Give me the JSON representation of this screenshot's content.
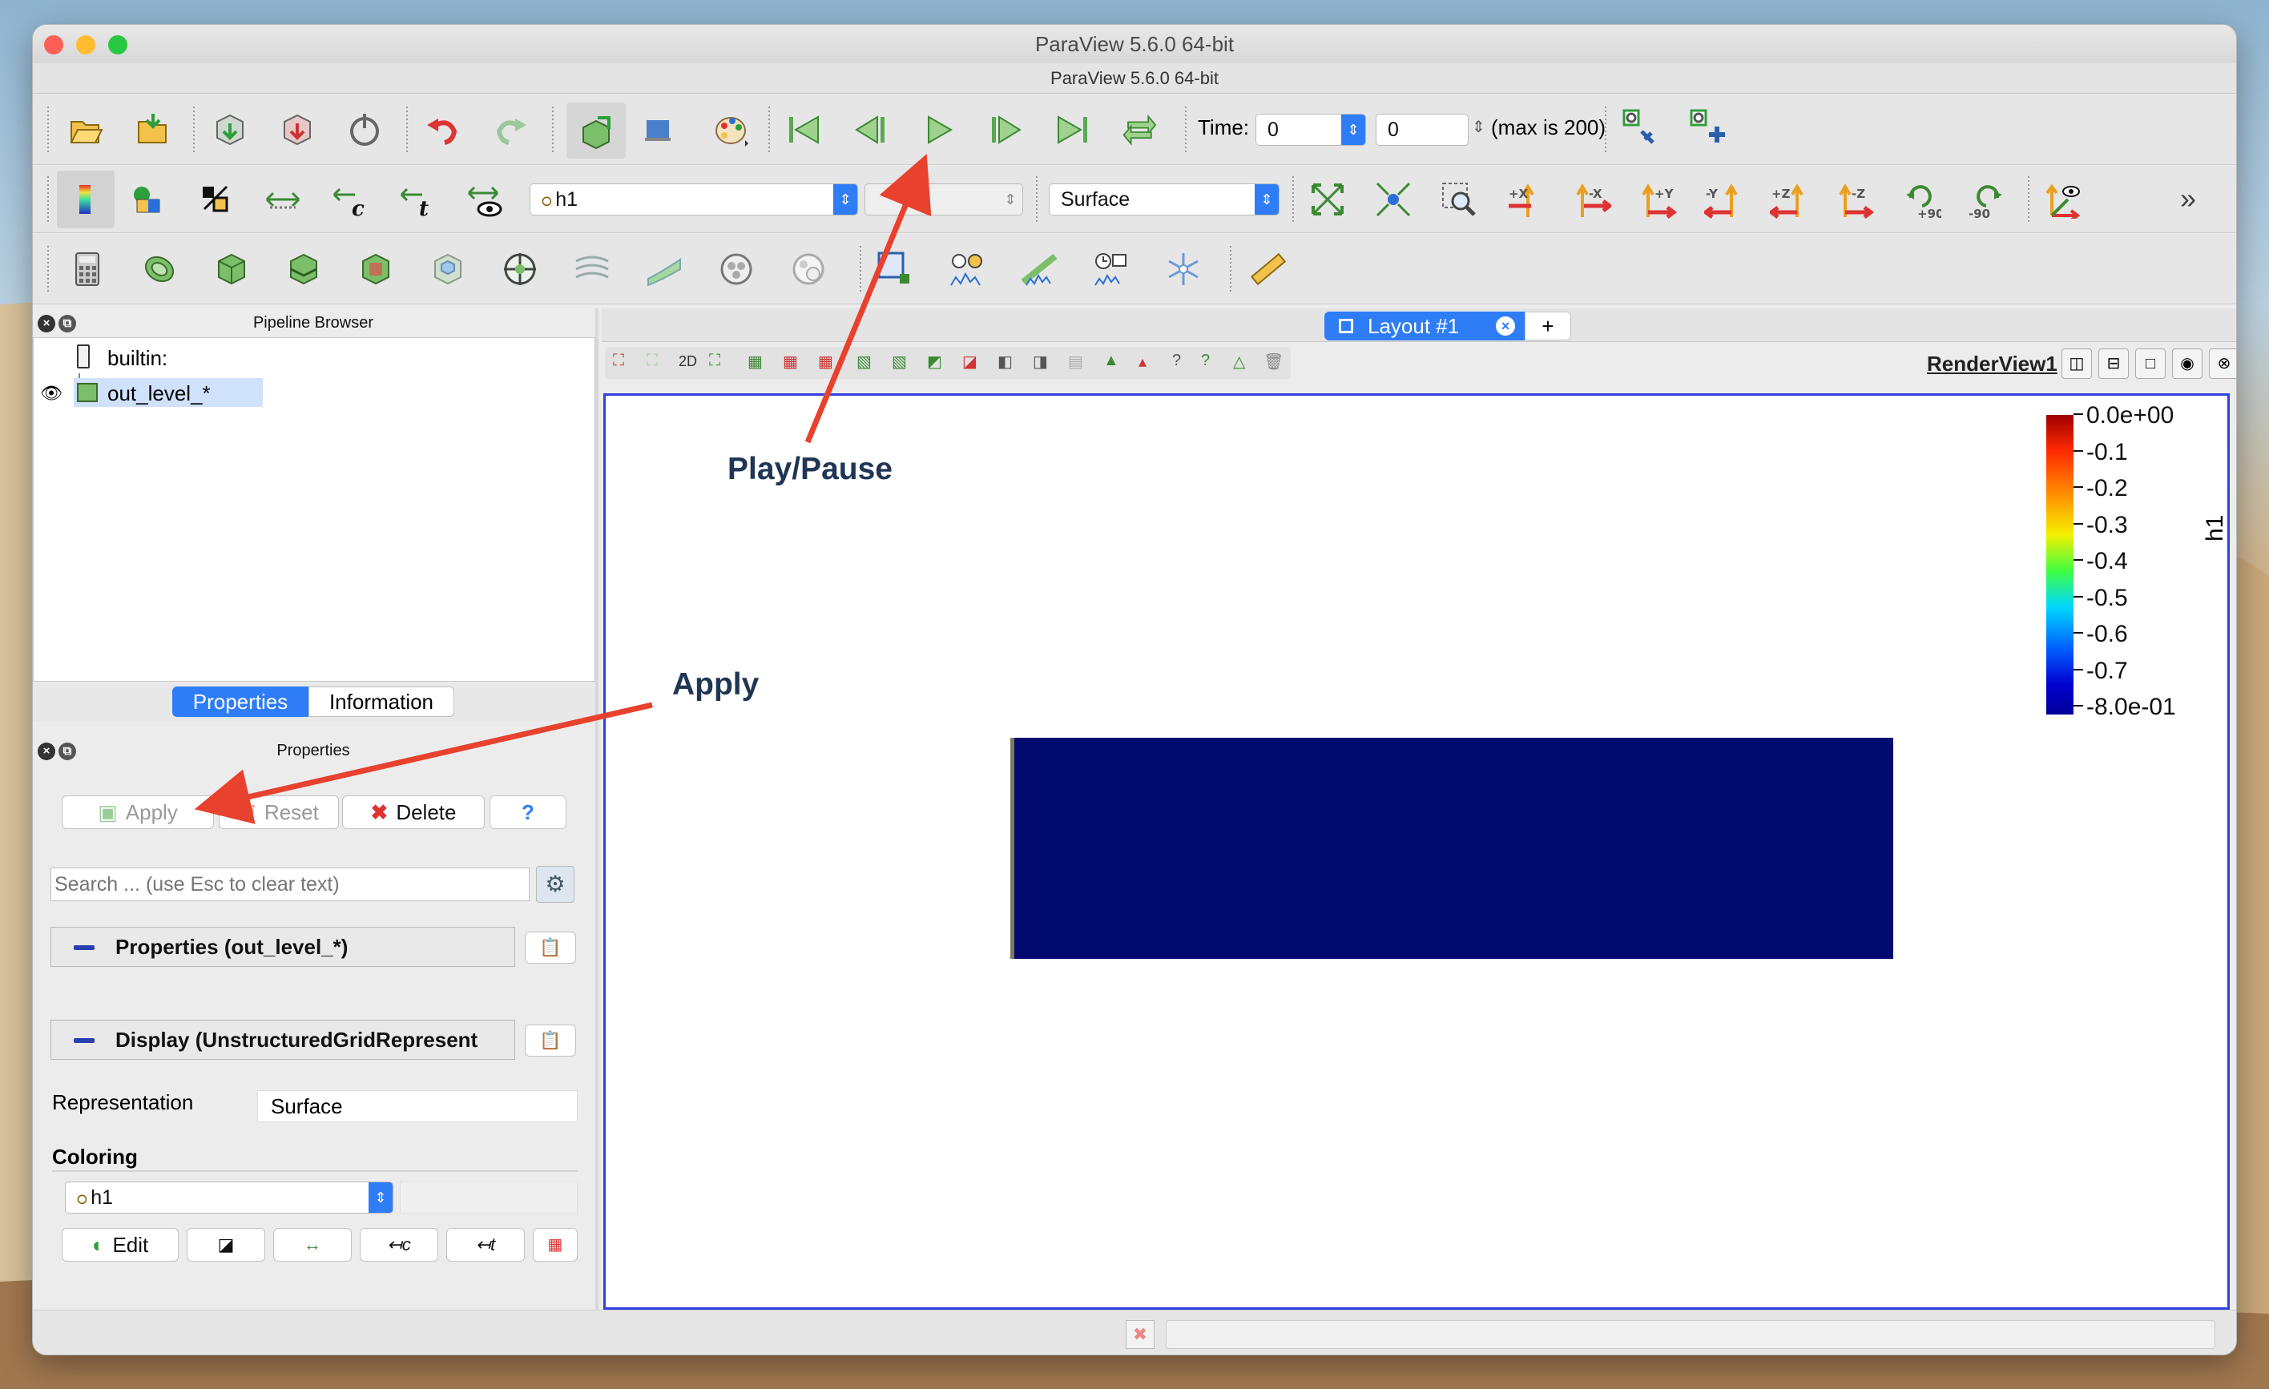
{
  "window": {
    "title": "ParaView 5.6.0 64-bit",
    "subtitle": "ParaView 5.6.0 64-bit"
  },
  "colors": {
    "accent": "#2f7df6",
    "selection": "#cfe1fb",
    "data_fill": "#010a6e",
    "arrow": "#e8412e"
  },
  "toolbar1": {
    "time_label": "Time:",
    "time_value": "0",
    "step_value": "0",
    "max_text": "(max is 200)"
  },
  "toolbar2": {
    "array_combo": "h1",
    "component_combo": "",
    "representation_combo": "Surface",
    "camera_buttons": [
      "+X",
      "-X",
      "+Y",
      "-Y",
      "+Z",
      "-Z",
      "+90",
      "-90"
    ],
    "more": "»"
  },
  "pipeline": {
    "title": "Pipeline Browser",
    "items": [
      {
        "label": "builtin:",
        "selected": false
      },
      {
        "label": "out_level_*",
        "selected": true
      }
    ]
  },
  "tabs": [
    {
      "label": "Properties",
      "active": true
    },
    {
      "label": "Information",
      "active": false
    }
  ],
  "properties": {
    "title": "Properties",
    "apply": "Apply",
    "reset": "Reset",
    "delete": "Delete",
    "help": "?",
    "search_placeholder": "Search ... (use Esc to clear text)",
    "section_properties": "Properties (out_level_*)",
    "section_display": "Display (UnstructuredGridRepresent",
    "representation_label": "Representation",
    "representation_value": "Surface",
    "coloring_label": "Coloring",
    "coloring_value": "h1",
    "edit": "Edit"
  },
  "layout": {
    "tab_label": "Layout #1",
    "add_tab": "+",
    "view_label": "RenderView1",
    "view_2d": "2D"
  },
  "colorbar": {
    "title": "h1",
    "labels": [
      "0.0e+00",
      "-0.1",
      "-0.2",
      "-0.3",
      "-0.4",
      "-0.5",
      "-0.6",
      "-0.7",
      "-8.0e-01"
    ]
  },
  "annotations": {
    "play": "Play/Pause",
    "apply": "Apply"
  }
}
